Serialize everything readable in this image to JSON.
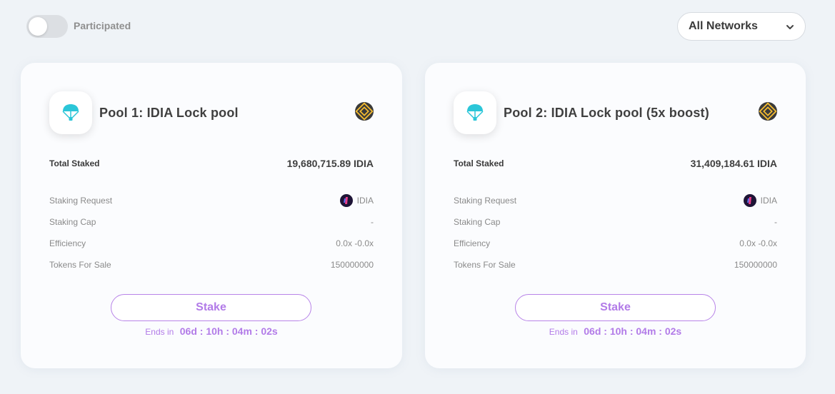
{
  "filter": {
    "participated_label": "Participated",
    "participated_on": false
  },
  "network_select": {
    "selected": "All Networks"
  },
  "pools": [
    {
      "title": "Pool 1: IDIA Lock pool",
      "chain_icon": "bnb-chain-icon",
      "total_staked_label": "Total Staked",
      "total_staked_value": "19,680,715.89 IDIA",
      "staking_request_label": "Staking Request",
      "staking_request_token": "IDIA",
      "staking_cap_label": "Staking Cap",
      "staking_cap_value": "-",
      "efficiency_label": "Efficiency",
      "efficiency_value": "0.0x -0.0x",
      "tokens_for_sale_label": "Tokens For Sale",
      "tokens_for_sale_value": "150000000",
      "stake_label": "Stake",
      "ends_label": "Ends in",
      "ends_time": "06d : 10h : 04m : 02s"
    },
    {
      "title": "Pool 2: IDIA Lock pool (5x boost)",
      "chain_icon": "bnb-chain-icon",
      "total_staked_label": "Total Staked",
      "total_staked_value": "31,409,184.61 IDIA",
      "staking_request_label": "Staking Request",
      "staking_request_token": "IDIA",
      "staking_cap_label": "Staking Cap",
      "staking_cap_value": "-",
      "efficiency_label": "Efficiency",
      "efficiency_value": "0.0x -0.0x",
      "tokens_for_sale_label": "Tokens For Sale",
      "tokens_for_sale_value": "150000000",
      "stake_label": "Stake",
      "ends_label": "Ends in",
      "ends_time": "06d : 10h : 04m : 02s"
    }
  ],
  "colors": {
    "accent": "#b27be8",
    "parachute": "#2bc6d8",
    "bnb_gold": "#f3ba2f",
    "page_bg": "#eff3f7"
  }
}
